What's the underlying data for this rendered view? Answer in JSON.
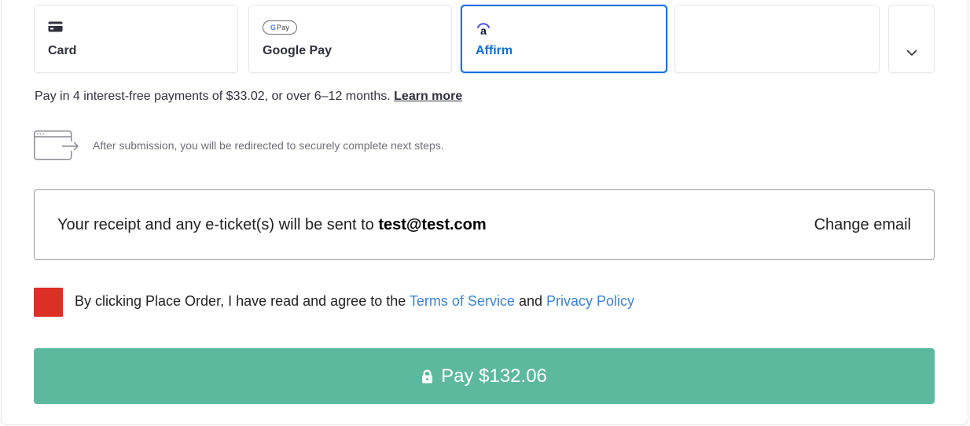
{
  "payment_tabs": {
    "card": {
      "label": "Card",
      "icon": "credit-card-icon"
    },
    "google_pay": {
      "label": "Google Pay",
      "icon": "google-pay-icon",
      "badge_g": "G",
      "badge_pay": "Pay"
    },
    "affirm": {
      "label": "Affirm",
      "icon": "affirm-logo-icon",
      "selected": true
    },
    "more": {
      "icon": "chevron-down-icon"
    }
  },
  "affirm_info": {
    "text": "Pay in 4 interest-free payments of $33.02, or over 6–12 months.",
    "link": "Learn more"
  },
  "redirect_notice": {
    "icon": "browser-redirect-icon",
    "text": "After submission, you will be redirected to securely complete next steps."
  },
  "receipt": {
    "prefix": "Your receipt and any e-ticket(s) will be sent to ",
    "email": "test@test.com",
    "change_label": "Change email"
  },
  "terms": {
    "prefix": "By clicking Place Order, I have read and agree to the ",
    "tos_link": "Terms of Service",
    "and": " and ",
    "privacy_link": "Privacy Policy"
  },
  "pay_button": {
    "label": "Pay $132.06",
    "icon": "lock-icon"
  },
  "colors": {
    "accent": "#0570de",
    "pay_button": "#5cb99d",
    "checkbox": "#dc3024",
    "link": "#3b82d4"
  }
}
